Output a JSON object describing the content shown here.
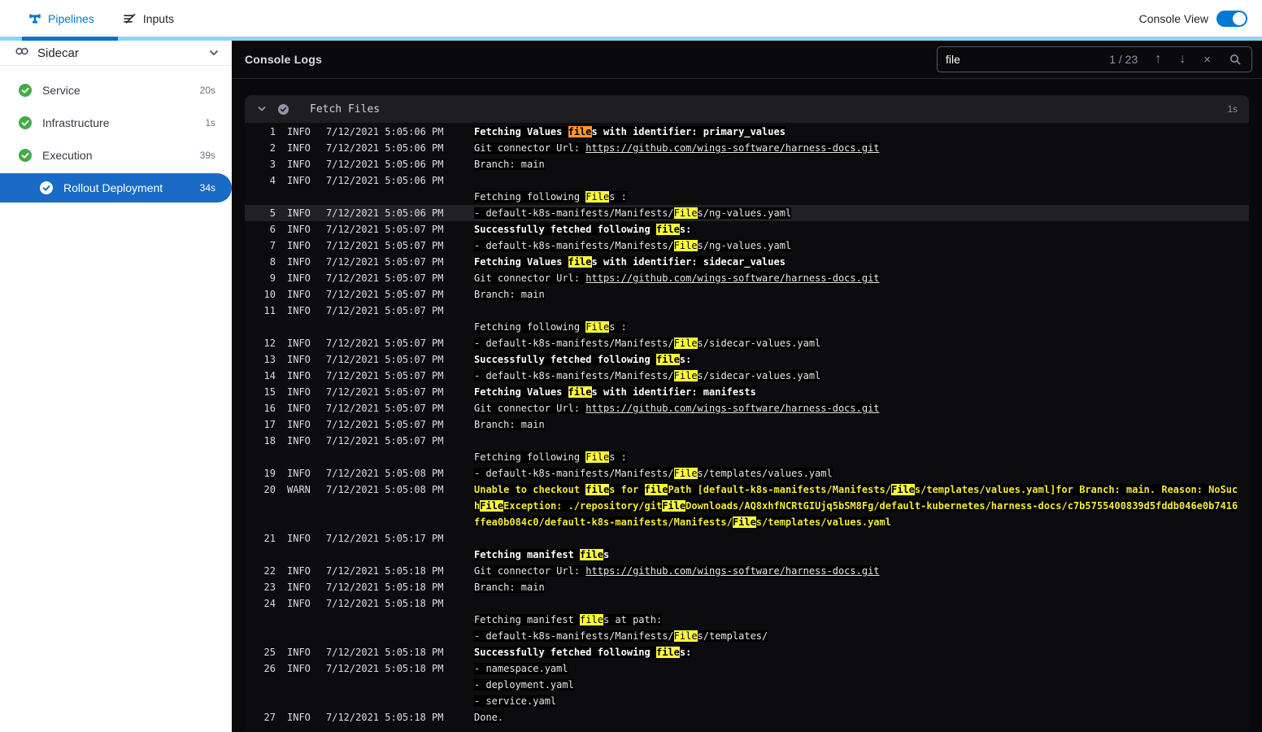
{
  "topbar": {
    "tabs": [
      {
        "label": "Pipelines"
      },
      {
        "label": "Inputs"
      }
    ],
    "console_view_label": "Console View",
    "toggle_on": true
  },
  "sidebar": {
    "stage_label": "Sidecar",
    "steps": [
      {
        "label": "Service",
        "duration": "20s",
        "status": "success",
        "selected": false
      },
      {
        "label": "Infrastructure",
        "duration": "1s",
        "status": "success",
        "selected": false
      },
      {
        "label": "Execution",
        "duration": "39s",
        "status": "success",
        "selected": false
      },
      {
        "label": "Rollout Deployment",
        "duration": "34s",
        "status": "success",
        "selected": true
      }
    ]
  },
  "console": {
    "title": "Console Logs",
    "search": {
      "value": "file",
      "count": "1 / 23",
      "up_icon": "↑",
      "down_icon": "↓",
      "close_icon": "×"
    },
    "section": {
      "title": "Fetch Files",
      "duration": "1s"
    },
    "colors": {
      "accent": "#0278d5",
      "selected_blue": "#1a6bc5",
      "success_green": "#42ab45",
      "match_current": "#ff9631",
      "match_other": "#fdfd3d",
      "warn_text": "#f3e83a",
      "console_bg": "#0a0a0c",
      "section_header_bg": "#1d1d22"
    },
    "rows": [
      {
        "n": 1,
        "lv": "INFO",
        "t": "7/12/2021 5:05:06 PM",
        "hl": false,
        "lines": [
          [
            [
              "b",
              "Fetching Values "
            ],
            [
              "o",
              "file"
            ],
            [
              "b",
              "s with identifier: primary_values"
            ]
          ]
        ]
      },
      {
        "n": 2,
        "lv": "INFO",
        "t": "7/12/2021 5:05:06 PM",
        "hl": false,
        "lines": [
          [
            [
              "n",
              "Git connector Url: "
            ],
            [
              "l",
              "https://github.com/wings-software/harness-docs.git"
            ]
          ]
        ]
      },
      {
        "n": 3,
        "lv": "INFO",
        "t": "7/12/2021 5:05:06 PM",
        "hl": false,
        "lines": [
          [
            [
              "n",
              "Branch: main"
            ]
          ]
        ]
      },
      {
        "n": 4,
        "lv": "INFO",
        "t": "7/12/2021 5:05:06 PM",
        "hl": false,
        "lines": [
          [],
          [
            [
              "n",
              "Fetching following "
            ],
            [
              "y",
              "File"
            ],
            [
              "n",
              "s :"
            ]
          ]
        ]
      },
      {
        "n": 5,
        "lv": "INFO",
        "t": "7/12/2021 5:05:06 PM",
        "hl": true,
        "lines": [
          [
            [
              "n",
              "- default-k8s-manifests/Manifests/"
            ],
            [
              "y",
              "File"
            ],
            [
              "n",
              "s/ng-values.yaml"
            ]
          ]
        ]
      },
      {
        "n": 6,
        "lv": "INFO",
        "t": "7/12/2021 5:05:07 PM",
        "hl": false,
        "lines": [
          [
            [
              "b",
              "Successfully fetched following "
            ],
            [
              "yb",
              "file"
            ],
            [
              "b",
              "s:"
            ]
          ]
        ]
      },
      {
        "n": 7,
        "lv": "INFO",
        "t": "7/12/2021 5:05:07 PM",
        "hl": false,
        "lines": [
          [
            [
              "n",
              "- default-k8s-manifests/Manifests/"
            ],
            [
              "y",
              "File"
            ],
            [
              "n",
              "s/ng-values.yaml"
            ]
          ]
        ]
      },
      {
        "n": 8,
        "lv": "INFO",
        "t": "7/12/2021 5:05:07 PM",
        "hl": false,
        "lines": [
          [
            [
              "b",
              "Fetching Values "
            ],
            [
              "yb",
              "file"
            ],
            [
              "b",
              "s with identifier: sidecar_values"
            ]
          ]
        ]
      },
      {
        "n": 9,
        "lv": "INFO",
        "t": "7/12/2021 5:05:07 PM",
        "hl": false,
        "lines": [
          [
            [
              "n",
              "Git connector Url: "
            ],
            [
              "l",
              "https://github.com/wings-software/harness-docs.git"
            ]
          ]
        ]
      },
      {
        "n": 10,
        "lv": "INFO",
        "t": "7/12/2021 5:05:07 PM",
        "hl": false,
        "lines": [
          [
            [
              "n",
              "Branch: main"
            ]
          ]
        ]
      },
      {
        "n": 11,
        "lv": "INFO",
        "t": "7/12/2021 5:05:07 PM",
        "hl": false,
        "lines": [
          [],
          [
            [
              "n",
              "Fetching following "
            ],
            [
              "y",
              "File"
            ],
            [
              "n",
              "s :"
            ]
          ]
        ]
      },
      {
        "n": 12,
        "lv": "INFO",
        "t": "7/12/2021 5:05:07 PM",
        "hl": false,
        "lines": [
          [
            [
              "n",
              "- default-k8s-manifests/Manifests/"
            ],
            [
              "y",
              "File"
            ],
            [
              "n",
              "s/sidecar-values.yaml"
            ]
          ]
        ]
      },
      {
        "n": 13,
        "lv": "INFO",
        "t": "7/12/2021 5:05:07 PM",
        "hl": false,
        "lines": [
          [
            [
              "b",
              "Successfully fetched following "
            ],
            [
              "yb",
              "file"
            ],
            [
              "b",
              "s:"
            ]
          ]
        ]
      },
      {
        "n": 14,
        "lv": "INFO",
        "t": "7/12/2021 5:05:07 PM",
        "hl": false,
        "lines": [
          [
            [
              "n",
              "- default-k8s-manifests/Manifests/"
            ],
            [
              "y",
              "File"
            ],
            [
              "n",
              "s/sidecar-values.yaml"
            ]
          ]
        ]
      },
      {
        "n": 15,
        "lv": "INFO",
        "t": "7/12/2021 5:05:07 PM",
        "hl": false,
        "lines": [
          [
            [
              "b",
              "Fetching Values "
            ],
            [
              "yb",
              "file"
            ],
            [
              "b",
              "s with identifier: manifests"
            ]
          ]
        ]
      },
      {
        "n": 16,
        "lv": "INFO",
        "t": "7/12/2021 5:05:07 PM",
        "hl": false,
        "lines": [
          [
            [
              "n",
              "Git connector Url: "
            ],
            [
              "l",
              "https://github.com/wings-software/harness-docs.git"
            ]
          ]
        ]
      },
      {
        "n": 17,
        "lv": "INFO",
        "t": "7/12/2021 5:05:07 PM",
        "hl": false,
        "lines": [
          [
            [
              "n",
              "Branch: main"
            ]
          ]
        ]
      },
      {
        "n": 18,
        "lv": "INFO",
        "t": "7/12/2021 5:05:07 PM",
        "hl": false,
        "lines": [
          [],
          [
            [
              "n",
              "Fetching following "
            ],
            [
              "y",
              "File"
            ],
            [
              "n",
              "s :"
            ]
          ]
        ]
      },
      {
        "n": 19,
        "lv": "INFO",
        "t": "7/12/2021 5:05:08 PM",
        "hl": false,
        "lines": [
          [
            [
              "n",
              "- default-k8s-manifests/Manifests/"
            ],
            [
              "y",
              "File"
            ],
            [
              "n",
              "s/templates/values.yaml"
            ]
          ]
        ]
      },
      {
        "n": 20,
        "lv": "WARN",
        "t": "7/12/2021 5:05:08 PM",
        "hl": false,
        "lines": [
          [
            [
              "w",
              "Unable to checkout "
            ],
            [
              "yw",
              "file"
            ],
            [
              "w",
              "s for "
            ],
            [
              "yw",
              "file"
            ],
            [
              "w",
              "Path [default-k8s-manifests/Manifests/"
            ],
            [
              "yw",
              "File"
            ],
            [
              "w",
              "s/templates/values.yaml]for Branch: main. Reason: NoSuch"
            ],
            [
              "yw",
              "File"
            ],
            [
              "w",
              "Exception: ./repository/git"
            ],
            [
              "yw",
              "File"
            ],
            [
              "w",
              "Downloads/AQ8xhfNCRtGIUjq5bSM8Fg/default-kubernetes/harness-docs/c7b5755400839d5fddb046e0b7416ffea0b084c0/default-k8s-manifests/Manifests/"
            ],
            [
              "yw",
              "File"
            ],
            [
              "w",
              "s/templates/values.yaml"
            ]
          ]
        ]
      },
      {
        "n": 21,
        "lv": "INFO",
        "t": "7/12/2021 5:05:17 PM",
        "hl": false,
        "lines": [
          [],
          [
            [
              "b",
              "Fetching manifest "
            ],
            [
              "yb",
              "file"
            ],
            [
              "b",
              "s"
            ]
          ]
        ]
      },
      {
        "n": 22,
        "lv": "INFO",
        "t": "7/12/2021 5:05:18 PM",
        "hl": false,
        "lines": [
          [
            [
              "n",
              "Git connector Url: "
            ],
            [
              "l",
              "https://github.com/wings-software/harness-docs.git"
            ]
          ]
        ]
      },
      {
        "n": 23,
        "lv": "INFO",
        "t": "7/12/2021 5:05:18 PM",
        "hl": false,
        "lines": [
          [
            [
              "n",
              "Branch: main"
            ]
          ]
        ]
      },
      {
        "n": 24,
        "lv": "INFO",
        "t": "7/12/2021 5:05:18 PM",
        "hl": false,
        "lines": [
          [],
          [
            [
              "n",
              "Fetching manifest "
            ],
            [
              "y",
              "file"
            ],
            [
              "n",
              "s at path:"
            ]
          ],
          [
            [
              "n",
              "- default-k8s-manifests/Manifests/"
            ],
            [
              "y",
              "File"
            ],
            [
              "n",
              "s/templates/"
            ]
          ]
        ]
      },
      {
        "n": 25,
        "lv": "INFO",
        "t": "7/12/2021 5:05:18 PM",
        "hl": false,
        "lines": [
          [
            [
              "b",
              "Successfully fetched following "
            ],
            [
              "yb",
              "file"
            ],
            [
              "b",
              "s:"
            ]
          ]
        ]
      },
      {
        "n": 26,
        "lv": "INFO",
        "t": "7/12/2021 5:05:18 PM",
        "hl": false,
        "lines": [
          [
            [
              "n",
              "- namespace.yaml"
            ]
          ],
          [
            [
              "n",
              "- deployment.yaml"
            ]
          ],
          [
            [
              "n",
              "- service.yaml"
            ]
          ]
        ]
      },
      {
        "n": 27,
        "lv": "INFO",
        "t": "7/12/2021 5:05:18 PM",
        "hl": false,
        "lines": [
          [
            [
              "n",
              "Done."
            ]
          ]
        ]
      }
    ]
  }
}
